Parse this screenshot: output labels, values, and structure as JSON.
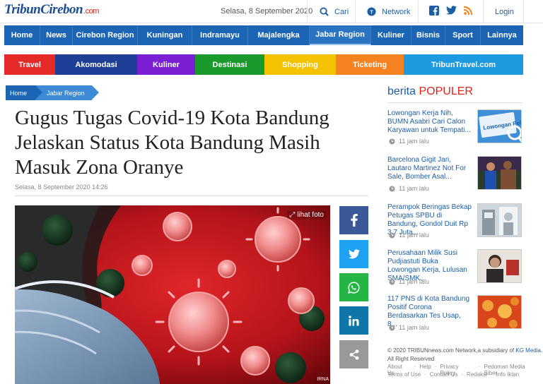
{
  "header": {
    "logo_part1": "Tribun",
    "logo_part2": "Cirebon",
    "logo_part3": ".com",
    "date": "Selasa, 8 September 2020",
    "search_label": "Cari",
    "network_label": "Network",
    "login_label": "Login",
    "social_icons": [
      "facebook-icon",
      "twitter-icon",
      "rss-icon"
    ]
  },
  "main_nav": [
    "Home",
    "News",
    "Cirebon Region",
    "Kuningan",
    "Indramayu",
    "Majalengka",
    "Jabar Region",
    "Kuliner",
    "Bisnis",
    "Sport",
    "Lainnya"
  ],
  "main_nav_active": "Jabar Region",
  "category_nav": [
    {
      "label": "Travel",
      "color": "#e52a2a"
    },
    {
      "label": "Akomodasi",
      "color": "#1d3f96"
    },
    {
      "label": "Kuliner",
      "color": "#7b1fd4"
    },
    {
      "label": "Destinasi",
      "color": "#1a9a2c"
    },
    {
      "label": "Shopping",
      "color": "#f5c200"
    },
    {
      "label": "Ticketing",
      "color": "#f58220"
    },
    {
      "label": "TribunTravel.com",
      "color": "#1e9ae0"
    }
  ],
  "breadcrumb": [
    "Home",
    "Jabar Region"
  ],
  "article": {
    "title": "Gugus Tugas Covid-19 Kota Bandung Jelaskan Status Kota Bandung Masih Masuk Zona Oranye",
    "date": "Selasa, 8 September 2020 14:26",
    "photo_link": "lihat foto",
    "photo_credit": "IRNA"
  },
  "share_buttons": [
    {
      "name": "facebook",
      "color": "#3b5998"
    },
    {
      "name": "twitter",
      "color": "#1da1f2"
    },
    {
      "name": "whatsapp",
      "color": "#25b544"
    },
    {
      "name": "linkedin",
      "color": "#0e76a8"
    },
    {
      "name": "share",
      "color": "#999999"
    }
  ],
  "popular": {
    "heading_word": "berita",
    "heading_accent": "POPULER",
    "items": [
      {
        "title": "Lowongan Kerja Nih, BUMN Asabri Cari Calon Karyawan untuk Tempati...",
        "time": "11 jam lalu",
        "thumb_text": "Lowongan Pekerjaan"
      },
      {
        "title": "Barcelona Gigit Jari, Lautaro Martinez Not For Sale, Bomber Asal...",
        "time": "11 jam lalu",
        "thumb_text": ""
      },
      {
        "title": "Perampok Beringas Bekap Petugas SPBU di Bandung, Gondol Duit Rp 3,7 Juta...",
        "time": "11 jam lalu",
        "thumb_text": ""
      },
      {
        "title": "Perusahaan Milik Susi Pudjiastuti Buka Lowongan Kerja, Lulusan SMA/SMK...",
        "time": "11 jam lalu",
        "thumb_text": ""
      },
      {
        "title": "117 PNS di Kota Bandung Positif Corona Berdasarkan Tes Usap, 8...",
        "time": "11 jam lalu",
        "thumb_text": ""
      }
    ]
  },
  "footer": {
    "copyright": "© 2020 TRIBUNnews.com Network,a subsidiary of ",
    "company": "KG Media.",
    "rights": "All Right Reserved",
    "links_row1": [
      "About Us",
      "·",
      "Help",
      "·",
      "Privacy Policy",
      "·",
      "Pedoman Media Siber"
    ],
    "links_row2": [
      "Terms of Use",
      "·",
      "Contact Us",
      "·",
      "Redaksi",
      "·",
      "Info Iklan"
    ]
  }
}
